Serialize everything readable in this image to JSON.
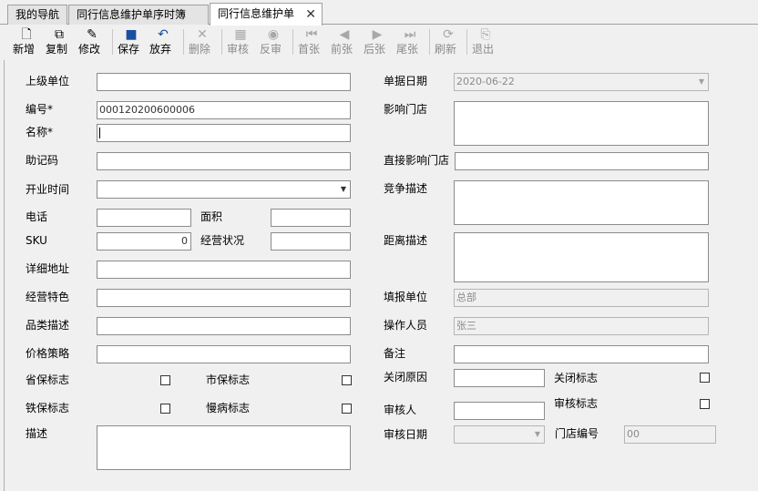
{
  "tabs": [
    {
      "label": "我的导航"
    },
    {
      "label": "同行信息维护单序时簿"
    },
    {
      "label": "同行信息维护单",
      "close": "✕"
    }
  ],
  "toolbar": {
    "new": "新增",
    "copy": "复制",
    "edit": "修改",
    "save": "保存",
    "discard": "放弃",
    "delete": "删除",
    "audit": "审核",
    "unaudit": "反审",
    "first": "首张",
    "prev": "前张",
    "next": "后张",
    "last": "尾张",
    "refresh": "刷新",
    "exit": "退出"
  },
  "form": {
    "parent_unit": {
      "label": "上级单位",
      "value": ""
    },
    "code": {
      "label": "编号*",
      "value": "000120200600006"
    },
    "name": {
      "label": "名称*",
      "value": ""
    },
    "mnemonic": {
      "label": "助记码",
      "value": ""
    },
    "open_time": {
      "label": "开业时间",
      "value": ""
    },
    "phone": {
      "label": "电话",
      "value": ""
    },
    "area": {
      "label": "面积",
      "value": ""
    },
    "sku": {
      "label": "SKU",
      "value": "0"
    },
    "biz_status": {
      "label": "经营状况",
      "value": ""
    },
    "address": {
      "label": "详细地址",
      "value": ""
    },
    "feature": {
      "label": "经营特色",
      "value": ""
    },
    "category": {
      "label": "品类描述",
      "value": ""
    },
    "price": {
      "label": "价格策略",
      "value": ""
    },
    "prov_ins": {
      "label": "省保标志",
      "checked": false
    },
    "city_ins": {
      "label": "市保标志",
      "checked": false
    },
    "rail_ins": {
      "label": "铁保标志",
      "checked": false
    },
    "chronic": {
      "label": "慢病标志",
      "checked": false
    },
    "desc": {
      "label": "描述",
      "value": ""
    },
    "doc_date": {
      "label": "单据日期",
      "value": "2020-06-22"
    },
    "affected_store": {
      "label": "影响门店",
      "value": ""
    },
    "direct_store": {
      "label": "直接影响门店",
      "value": ""
    },
    "competition": {
      "label": "竞争描述",
      "value": ""
    },
    "distance": {
      "label": "距离描述",
      "value": ""
    },
    "fill_unit": {
      "label": "填报单位",
      "value": "总部"
    },
    "operator": {
      "label": "操作人员",
      "value": "张三"
    },
    "remark": {
      "label": "备注",
      "value": ""
    },
    "close_reason": {
      "label": "关闭原因",
      "value": ""
    },
    "close_flag": {
      "label": "关闭标志",
      "checked": false
    },
    "auditor": {
      "label": "审核人",
      "value": ""
    },
    "audit_flag": {
      "label": "审核标志",
      "checked": false
    },
    "audit_date": {
      "label": "审核日期",
      "value": ""
    },
    "store_code": {
      "label": "门店编号",
      "value": "00"
    }
  }
}
